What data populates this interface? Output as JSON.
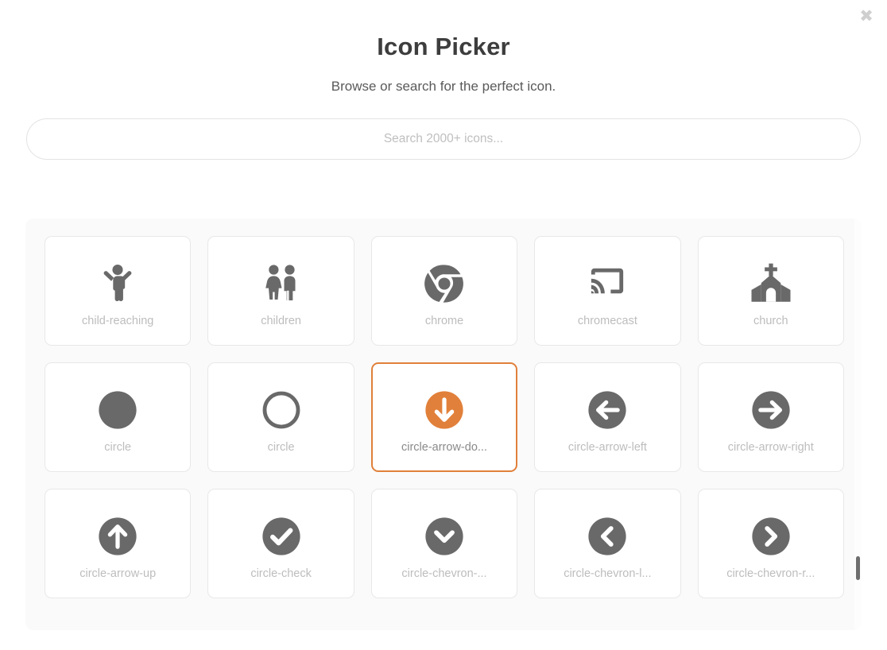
{
  "dialog": {
    "title": "Icon Picker",
    "subtitle": "Browse or search for the perfect icon.",
    "close_label": "✖"
  },
  "search": {
    "placeholder": "Search 2000+ icons...",
    "value": ""
  },
  "theme": {
    "accent": "#e1803a",
    "icon_gray": "#696969",
    "label_gray": "#bdbdbd",
    "selected_label_gray": "#8a8a8a",
    "panel_bg": "#fafafa",
    "tile_border": "#e8e8e8"
  },
  "grid": {
    "columns": 5,
    "selected_index": 7,
    "icons": [
      {
        "label": "child-reaching",
        "icon": "child-reaching-icon",
        "selected": false
      },
      {
        "label": "children",
        "icon": "children-icon",
        "selected": false
      },
      {
        "label": "chrome",
        "icon": "chrome-icon",
        "selected": false
      },
      {
        "label": "chromecast",
        "icon": "chromecast-icon",
        "selected": false
      },
      {
        "label": "church",
        "icon": "church-icon",
        "selected": false
      },
      {
        "label": "circle",
        "icon": "circle-filled-icon",
        "selected": false
      },
      {
        "label": "circle",
        "icon": "circle-outline-icon",
        "selected": false
      },
      {
        "label": "circle-arrow-do...",
        "icon": "circle-arrow-down-icon",
        "selected": true
      },
      {
        "label": "circle-arrow-left",
        "icon": "circle-arrow-left-icon",
        "selected": false
      },
      {
        "label": "circle-arrow-right",
        "icon": "circle-arrow-right-icon",
        "selected": false
      },
      {
        "label": "circle-arrow-up",
        "icon": "circle-arrow-up-icon",
        "selected": false
      },
      {
        "label": "circle-check",
        "icon": "circle-check-icon",
        "selected": false
      },
      {
        "label": "circle-chevron-...",
        "icon": "circle-chevron-down-icon",
        "selected": false
      },
      {
        "label": "circle-chevron-l...",
        "icon": "circle-chevron-left-icon",
        "selected": false
      },
      {
        "label": "circle-chevron-r...",
        "icon": "circle-chevron-right-icon",
        "selected": false
      }
    ]
  },
  "scrollbar": {
    "visible": true
  }
}
